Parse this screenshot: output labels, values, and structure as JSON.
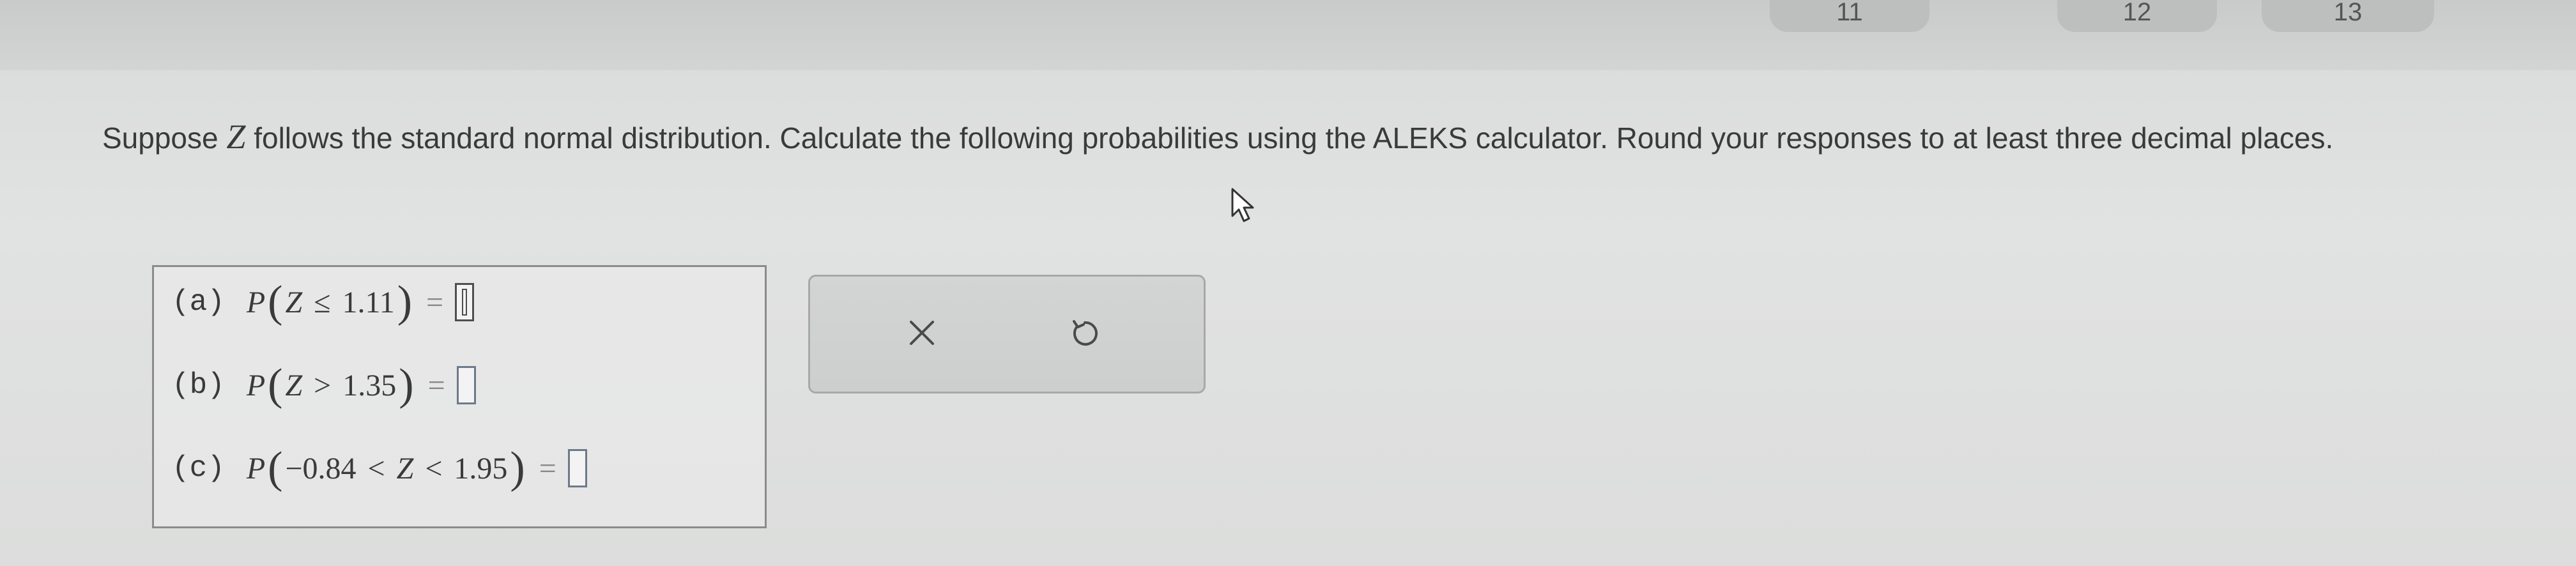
{
  "top_tabs": [
    {
      "label": "11"
    },
    {
      "label": "12"
    },
    {
      "label": "13"
    }
  ],
  "question": {
    "text_before": "Suppose",
    "variable": "Z",
    "text_after": "follows the standard normal distribution. Calculate the following probabilities using the ALEKS calculator. Round your responses to at least three decimal places."
  },
  "parts": [
    {
      "label": "(a)",
      "fn": "P",
      "open": "(",
      "var": "Z",
      "op": "≤",
      "value": "1.11",
      "close": ")",
      "equals": "=",
      "answer": ""
    },
    {
      "label": "(b)",
      "fn": "P",
      "open": "(",
      "var": "Z",
      "op": ">",
      "value": "1.35",
      "close": ")",
      "equals": "=",
      "answer": ""
    },
    {
      "label": "(c)",
      "fn": "P",
      "open": "(",
      "lower": "−0.84",
      "op1": "<",
      "var": "Z",
      "op2": "<",
      "upper": "1.95",
      "close": ")",
      "equals": "=",
      "answer": ""
    }
  ],
  "toolbox": {
    "clear_icon": "close-icon",
    "undo_icon": "undo-icon"
  },
  "colors": {
    "background": "#dcdddc",
    "text": "#3a3a3a",
    "box_border": "#8b8b8b"
  }
}
